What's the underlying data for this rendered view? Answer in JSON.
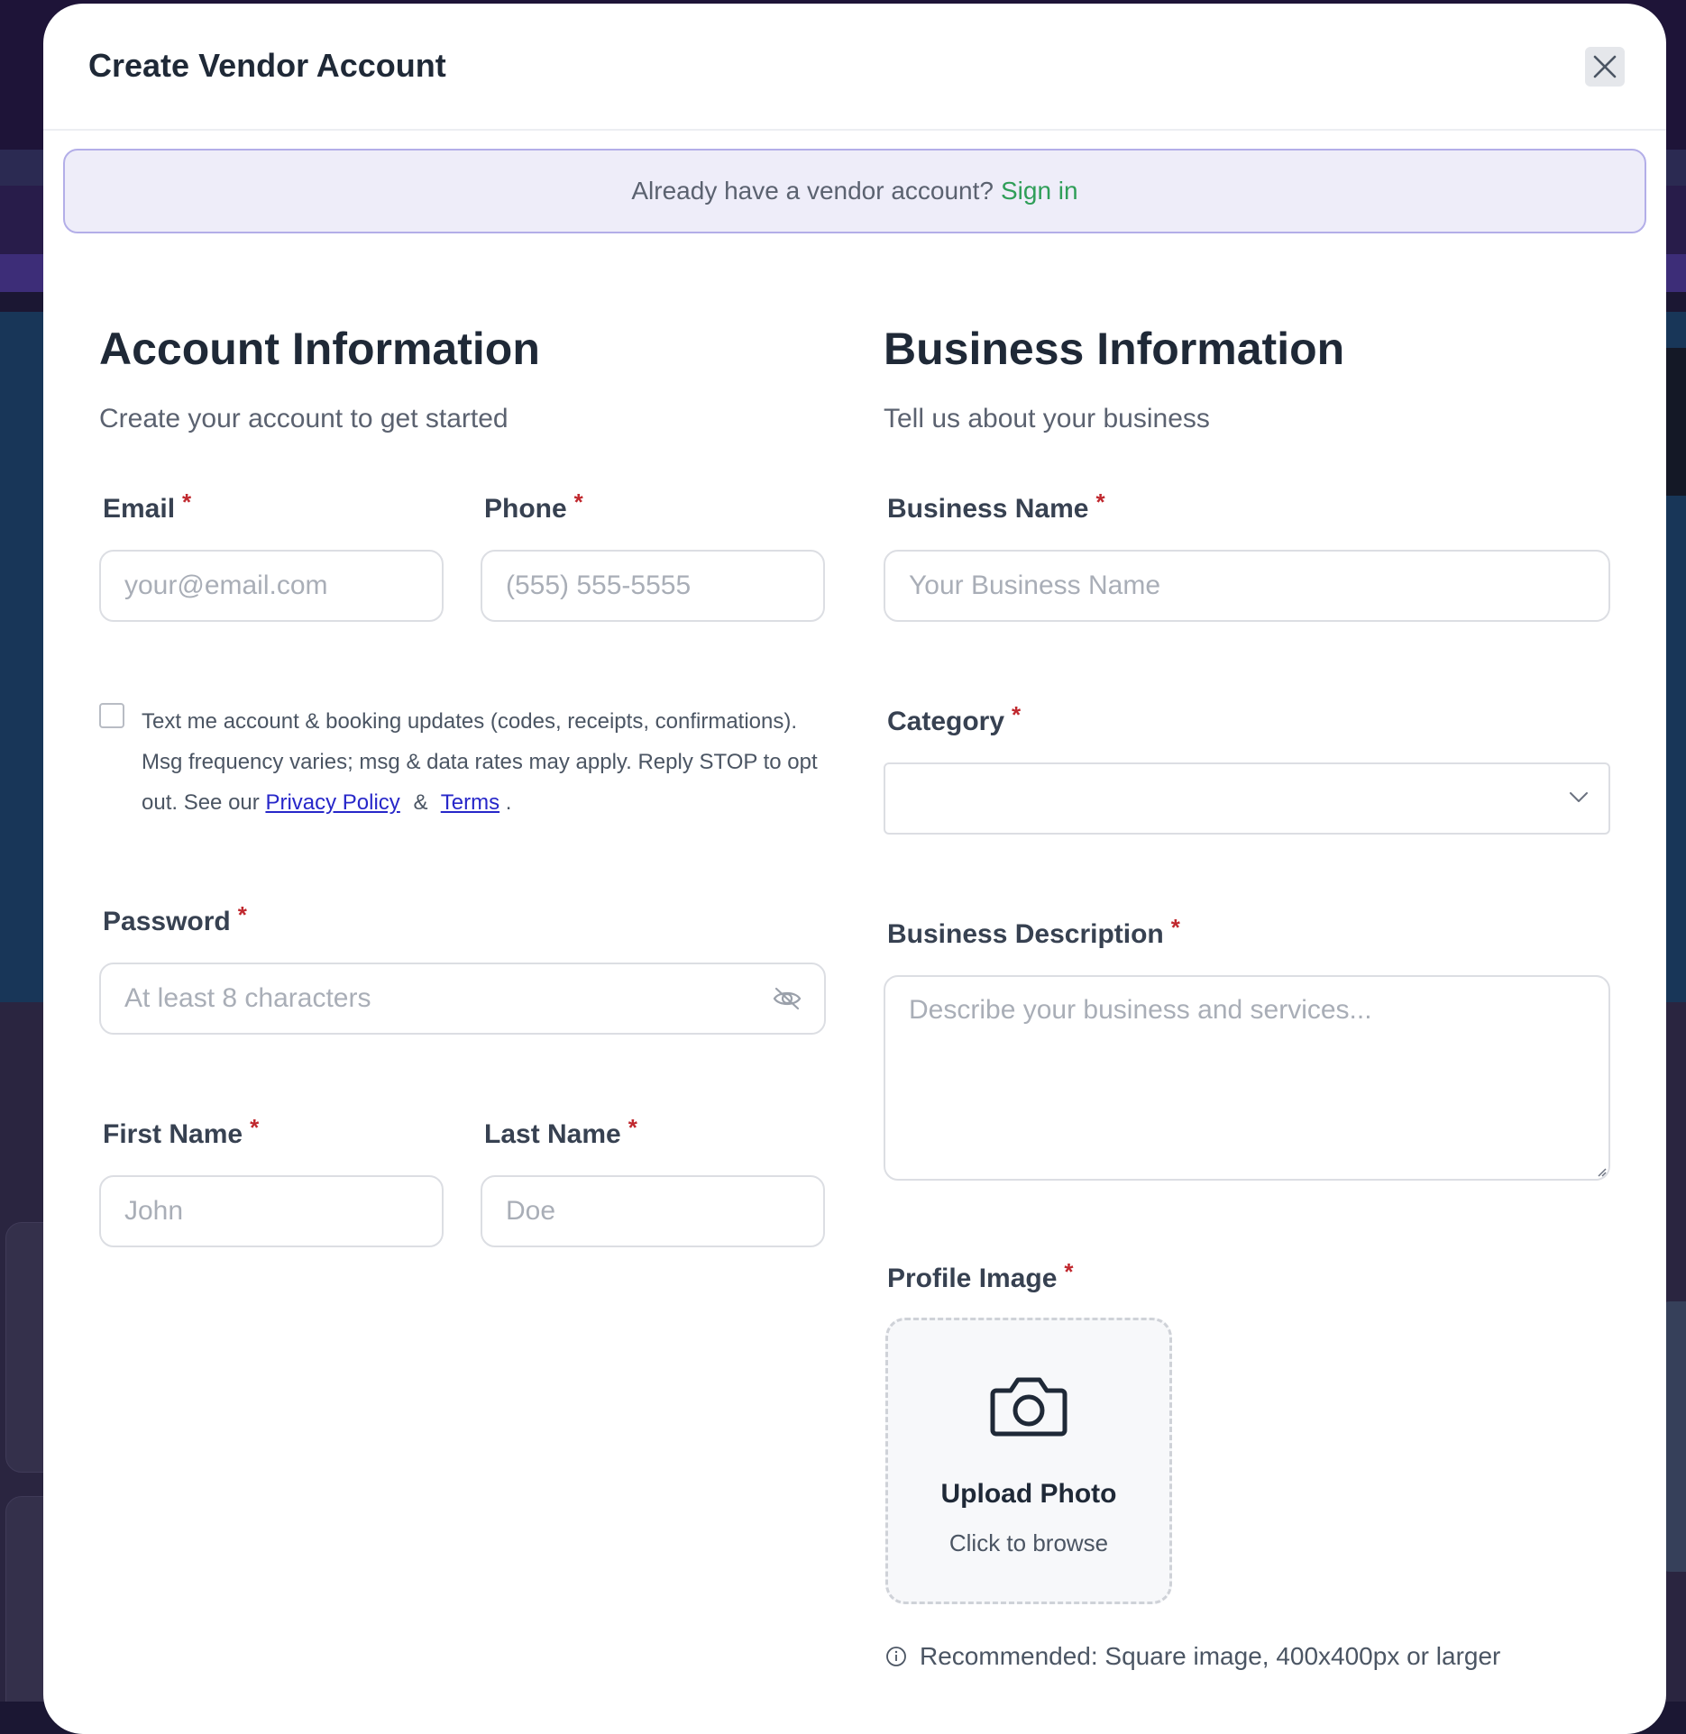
{
  "modal": {
    "title": "Create Vendor Account",
    "close_icon": "close-icon"
  },
  "signin_banner": {
    "prompt": "Already have a vendor account?",
    "link": "Sign in",
    "link_color": "#2f9e58"
  },
  "account": {
    "title": "Account Information",
    "subtitle": "Create your account to get started",
    "email": {
      "label": "Email",
      "placeholder": "your@email.com",
      "value": ""
    },
    "phone": {
      "label": "Phone",
      "placeholder": "(555) 555-5555",
      "value": ""
    },
    "sms_consent": {
      "checked": false,
      "text_before": "Text me account & booking updates (codes, receipts, confirmations). Msg frequency varies; msg & data rates may apply. Reply STOP to opt out. See our",
      "privacy_link": "Privacy Policy",
      "amp": "&",
      "terms_link": "Terms",
      "period": "."
    },
    "password": {
      "label": "Password",
      "placeholder": "At least 8 characters",
      "value": "",
      "toggle_icon": "eye-off-icon"
    },
    "first_name": {
      "label": "First Name",
      "placeholder": "John",
      "value": ""
    },
    "last_name": {
      "label": "Last Name",
      "placeholder": "Doe",
      "value": ""
    }
  },
  "business": {
    "title": "Business Information",
    "subtitle": "Tell us about your business",
    "business_name": {
      "label": "Business Name",
      "placeholder": "Your Business Name",
      "value": ""
    },
    "category": {
      "label": "Category",
      "selected": "",
      "icon": "chevron-down-icon"
    },
    "description": {
      "label": "Business Description",
      "placeholder": "Describe your business and services...",
      "value": ""
    },
    "profile_image": {
      "label": "Profile Image",
      "upload_title": "Upload Photo",
      "upload_sub": "Click to browse",
      "icon": "camera-icon",
      "hint": "Recommended: Square image, 400x400px or larger",
      "hint_icon": "info-icon"
    }
  },
  "required_marker": "*",
  "colors": {
    "required": "#c0282e",
    "banner_bg": "#eeedf9",
    "banner_border": "#b3aee8",
    "link_blue": "#2727c9"
  }
}
